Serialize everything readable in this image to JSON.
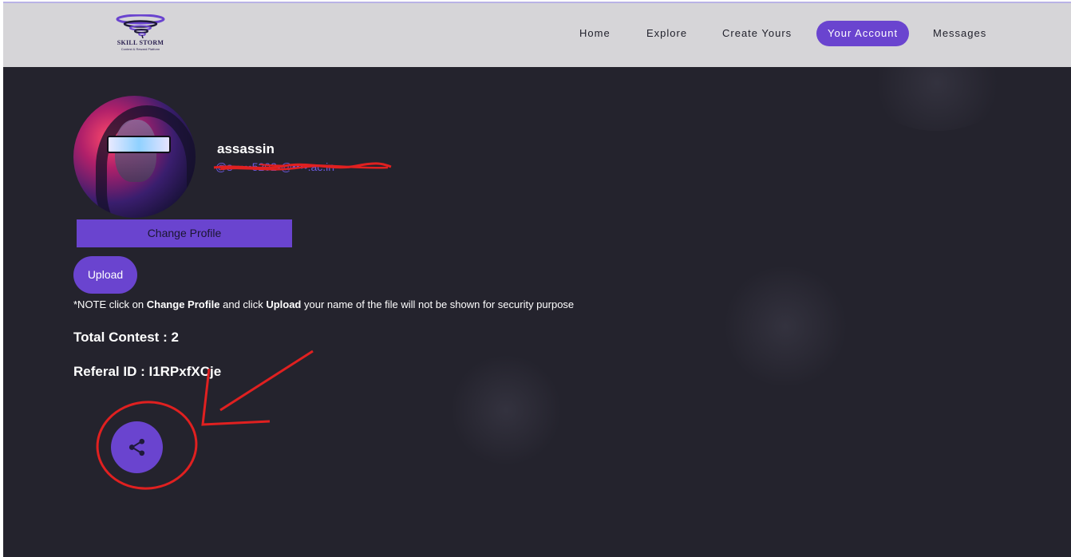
{
  "brand": {
    "name": "SKILL STORM",
    "tagline": "Contest & Reward Platform",
    "accent": "#6a44cf"
  },
  "nav": {
    "items": [
      {
        "label": "Home"
      },
      {
        "label": "Explore"
      },
      {
        "label": "Create Yours"
      },
      {
        "label": "Your Account",
        "active": true
      },
      {
        "label": "Messages"
      }
    ]
  },
  "profile": {
    "username": "assassin",
    "email_redacted": "@s•••••5202•@••••.ac.in",
    "change_profile_label": "Change Profile",
    "upload_label": "Upload"
  },
  "note": {
    "prefix": "*NOTE click on ",
    "bold1": "Change Profile",
    "mid": " and click ",
    "bold2": "Upload",
    "suffix": " your name of the file will not be shown for security purpose"
  },
  "stats": {
    "total_contest": "Total Contest : 2",
    "referal_id": "Referal ID : I1RPxfXCje"
  },
  "share": {
    "icon": "share-icon"
  },
  "colors": {
    "background": "#24232d",
    "navbar": "#d6d5d8",
    "annotation": "#e02020"
  }
}
